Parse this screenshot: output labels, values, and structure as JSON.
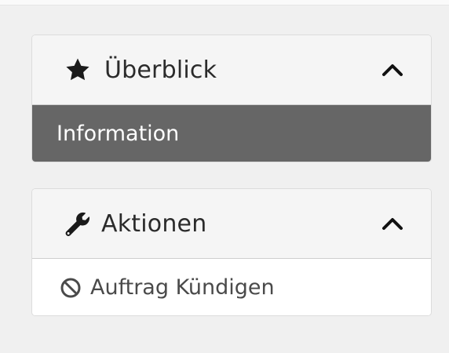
{
  "panels": {
    "overview": {
      "title": "Überblick",
      "icon": "star-icon",
      "items": [
        {
          "label": "Information",
          "active": true
        }
      ]
    },
    "actions": {
      "title": "Aktionen",
      "icon": "wrench-icon",
      "items": [
        {
          "label": "Auftrag Kündigen",
          "icon": "ban-icon"
        }
      ]
    }
  },
  "colors": {
    "background": "#f0f0f0",
    "header_bg": "#f5f5f5",
    "active_item_bg": "#666666",
    "active_item_text": "#ffffff",
    "text": "#333333"
  }
}
